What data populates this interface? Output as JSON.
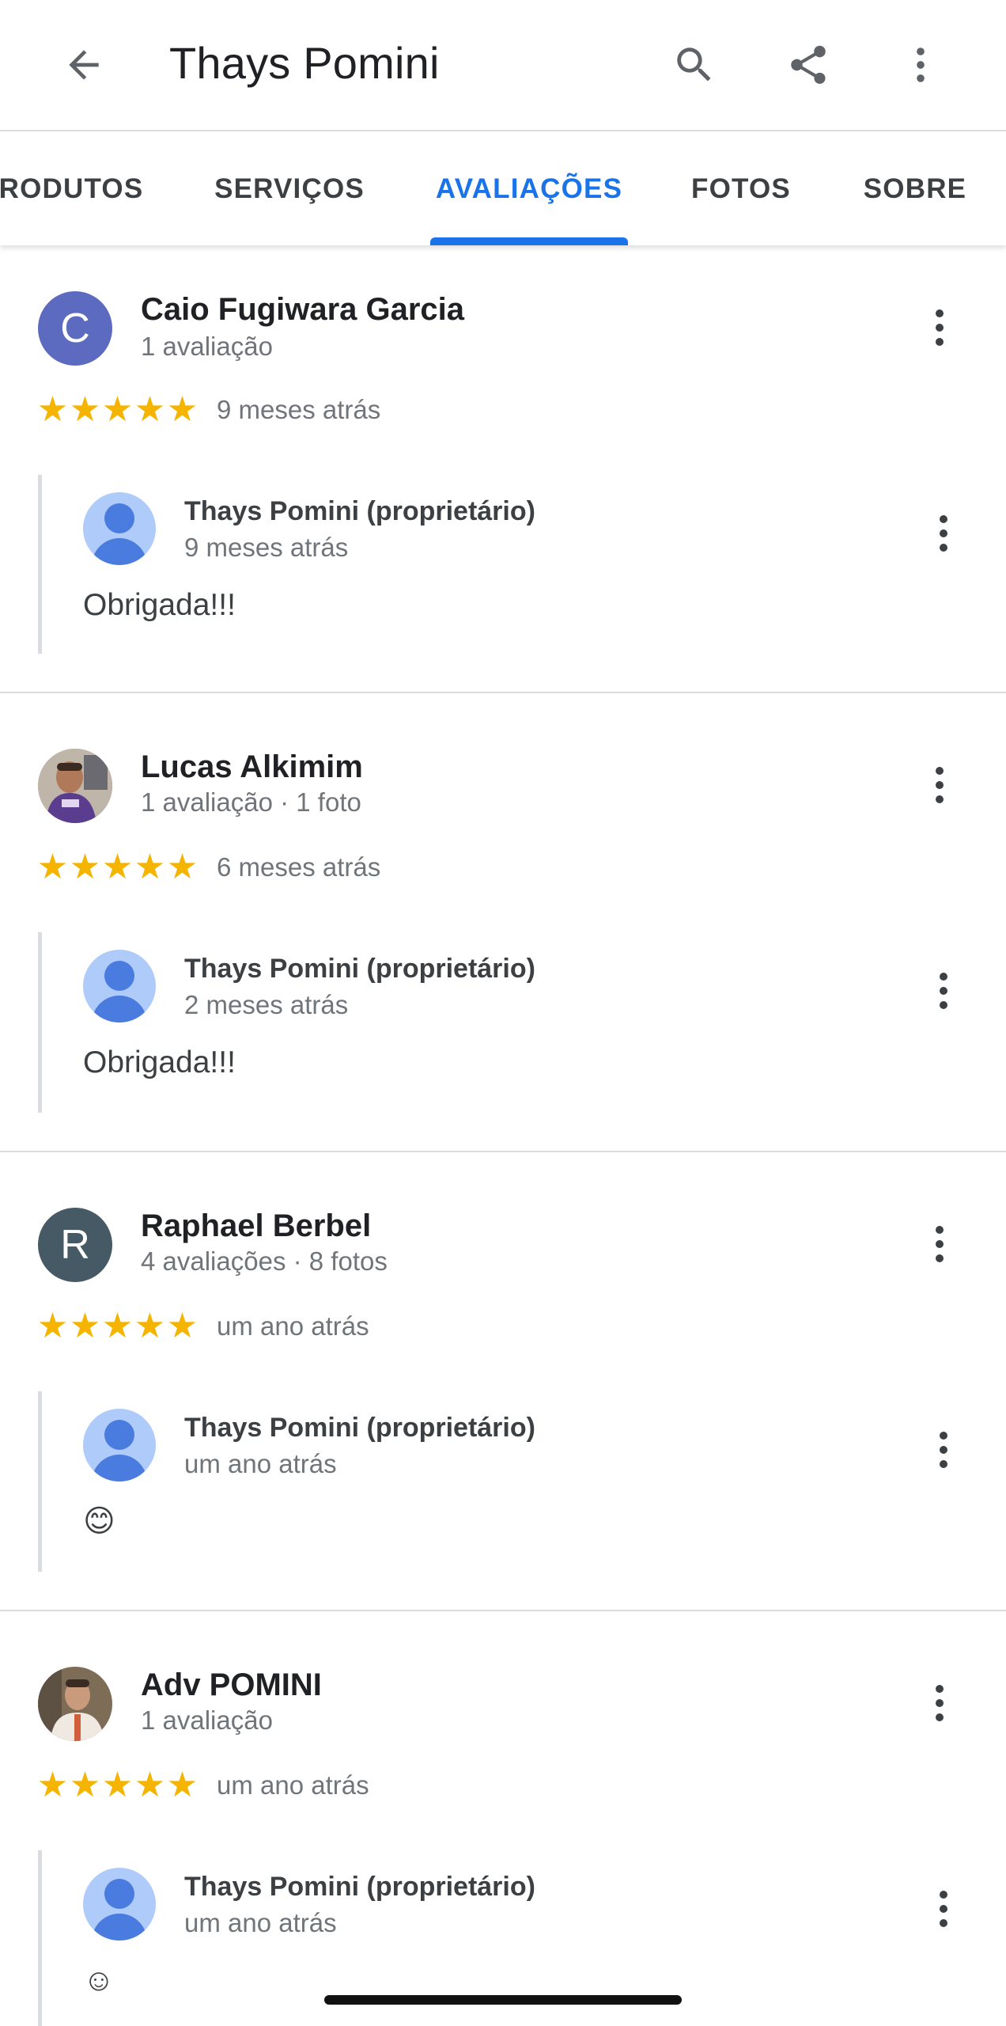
{
  "app_bar": {
    "title": "Thays Pomini",
    "back_icon": "arrow-back-icon",
    "actions": [
      "search-icon",
      "share-icon",
      "more-vert-icon"
    ]
  },
  "tabs": [
    {
      "label": "PRODUTOS",
      "active": false
    },
    {
      "label": "SERVIÇOS",
      "active": false
    },
    {
      "label": "AVALIAÇÕES",
      "active": true
    },
    {
      "label": "FOTOS",
      "active": false
    },
    {
      "label": "SOBRE",
      "active": false
    }
  ],
  "tabs_visible": {
    "produtos_clipped": "RODUTOS"
  },
  "colors": {
    "accent": "#1a73e8",
    "star": "#f4b400",
    "avatar_c": "#5c6bc0",
    "avatar_r": "#455a64"
  },
  "reviews": [
    {
      "name": "Caio Fugiwara Garcia",
      "meta": "1 avaliação",
      "avatar_letter": "C",
      "rating": 5,
      "time": "9 meses atrás",
      "reply": {
        "name": "Thays Pomini (proprietário)",
        "time": "9 meses atrás",
        "text": "Obrigada!!!"
      }
    },
    {
      "name": "Lucas Alkimim",
      "meta": "1 avaliação · 1 foto",
      "avatar_letter": "",
      "rating": 5,
      "time": "6 meses atrás",
      "reply": {
        "name": "Thays Pomini (proprietário)",
        "time": "2 meses atrás",
        "text": "Obrigada!!!"
      }
    },
    {
      "name": "Raphael Berbel",
      "meta": "4 avaliações · 8 fotos",
      "avatar_letter": "R",
      "rating": 5,
      "time": "um ano atrás",
      "reply": {
        "name": "Thays Pomini (proprietário)",
        "time": "um ano atrás",
        "text": "😊"
      }
    },
    {
      "name": "Adv POMINI",
      "meta": "1 avaliação",
      "avatar_letter": "",
      "rating": 5,
      "time": "um ano atrás",
      "reply": {
        "name": "Thays Pomini (proprietário)",
        "time": "um ano atrás",
        "text": "☺"
      }
    }
  ]
}
